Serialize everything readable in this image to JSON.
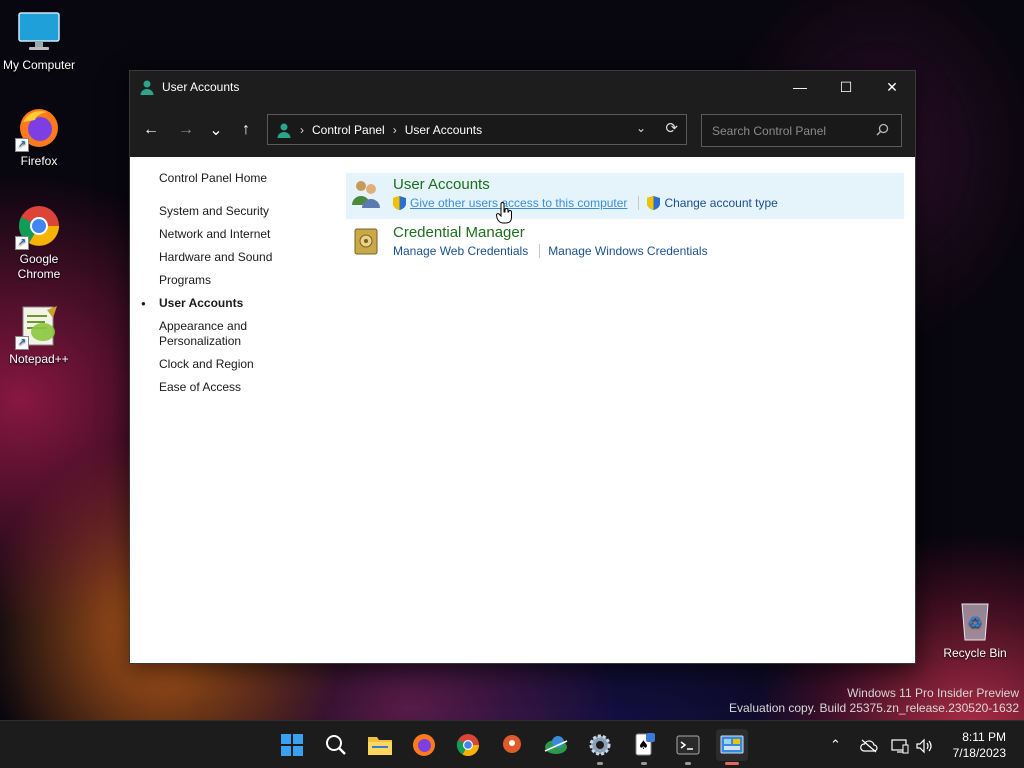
{
  "desktop": {
    "icons": [
      {
        "label": "My Computer"
      },
      {
        "label": "Firefox"
      },
      {
        "label": "Google Chrome"
      },
      {
        "label": "Notepad++"
      },
      {
        "label": "Recycle Bin"
      }
    ],
    "watermark_line1": "Windows 11 Pro Insider Preview",
    "watermark_line2": "Evaluation copy. Build 25375.zn_release.230520-1632"
  },
  "window": {
    "title": "User Accounts",
    "controls": {
      "minimize": "—",
      "maximize": "☐",
      "close": "✕"
    },
    "toolbar": {
      "back": "←",
      "forward": "→",
      "recent": "⌄",
      "up": "↑",
      "breadcrumb": [
        "Control Panel",
        "User Accounts"
      ],
      "search_placeholder": "Search Control Panel"
    }
  },
  "sidebar": {
    "home": "Control Panel Home",
    "items": [
      "System and Security",
      "Network and Internet",
      "Hardware and Sound",
      "Programs",
      "User Accounts",
      "Appearance and Personalization",
      "Clock and Region",
      "Ease of Access"
    ],
    "active": "User Accounts"
  },
  "categories": [
    {
      "title": "User Accounts",
      "icon": "users-icon",
      "links": [
        "Give other users access to this computer",
        "Change account type"
      ]
    },
    {
      "title": "Credential Manager",
      "icon": "vault-icon",
      "links": [
        "Manage Web Credentials",
        "Manage Windows Credentials"
      ]
    }
  ],
  "taskbar": {
    "apps": [
      "start",
      "search",
      "file-explorer",
      "firefox",
      "chrome",
      "maps",
      "network-tool",
      "settings",
      "solitaire",
      "terminal",
      "control-panel"
    ],
    "time": "8:11 PM",
    "date": "7/18/2023"
  },
  "colors": {
    "accent": "#1e6e1e",
    "link": "#1b4f8f",
    "hover": "#e5f3fb",
    "titlebar": "#1d1d1d"
  }
}
